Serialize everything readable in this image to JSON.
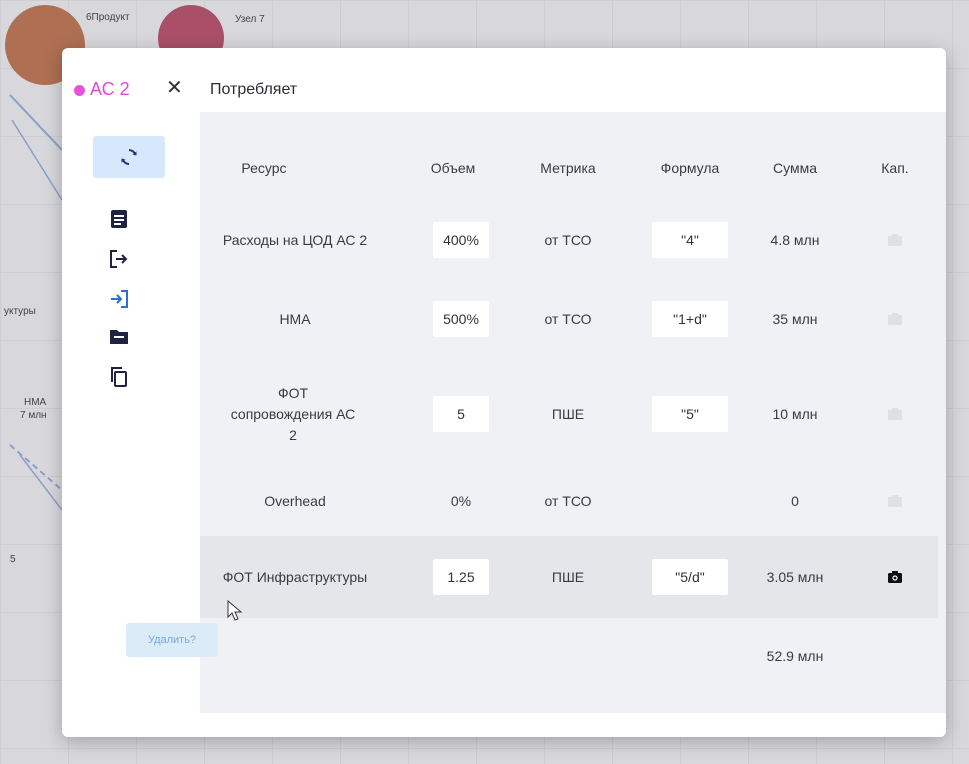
{
  "background": {
    "node1_label": "6Продукт",
    "node2_label": "Узел 7",
    "side_label_1": "уктуры",
    "side_label_2": "НМА",
    "side_label_3": "7 млн",
    "side_label_4": "5"
  },
  "modal": {
    "tab": {
      "label": "АС 2",
      "dot_color": "#e454d8"
    },
    "close_symbol": "✕",
    "section_title": "Потребляет"
  },
  "sidebar_icons": [
    "sync-icon",
    "document-icon",
    "logout-icon",
    "login-icon",
    "folder-icon",
    "copy-icon"
  ],
  "table": {
    "headers": [
      "Ресурс",
      "Объем",
      "Метрика",
      "Формула",
      "Сумма",
      "Кап."
    ],
    "rows": [
      {
        "resource": "Расходы на ЦОД АС 2",
        "volume": "400%",
        "metric": "от ТСО",
        "formula": "\"4\"",
        "sum": "4.8 млн",
        "cap_active": false
      },
      {
        "resource": "НМА",
        "volume": "500%",
        "metric": "от ТСО",
        "formula": "\"1+d\"",
        "sum": "35 млн",
        "cap_active": false
      },
      {
        "resource": "ФОТ сопровождения АС 2",
        "volume": "5",
        "metric": "ПШЕ",
        "formula": "\"5\"",
        "sum": "10 млн",
        "cap_active": false
      },
      {
        "resource": "Overhead",
        "volume": "0%",
        "metric": "от ТСО",
        "formula": "",
        "sum": "0",
        "cap_active": false
      },
      {
        "resource": "ФОТ Инфраструктуры",
        "volume": "1.25",
        "metric": "ПШЕ",
        "formula": "\"5/d\"",
        "sum": "3.05 млн",
        "cap_active": true
      }
    ],
    "total": "52.9 млн",
    "delete_label": "Удалить?"
  }
}
